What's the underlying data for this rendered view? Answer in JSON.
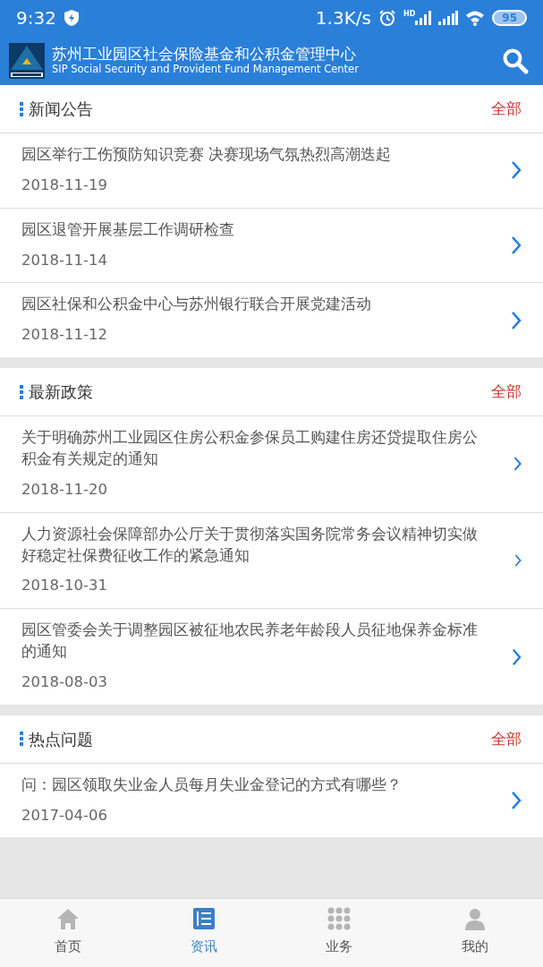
{
  "status_bar": {
    "time": "9:32",
    "speed": "1.3K/s",
    "hd_label": "HD",
    "battery": "95"
  },
  "header": {
    "title": "苏州工业园区社会保险基金和公积金管理中心",
    "subtitle": "SIP Social Security and Provident Fund Management Center"
  },
  "sections": [
    {
      "title": "新闻公告",
      "more": "全部",
      "items": [
        {
          "title": "园区举行工伤预防知识竞赛 决赛现场气氛热烈高潮迭起",
          "date": "2018-11-19"
        },
        {
          "title": "园区退管开展基层工作调研检查",
          "date": "2018-11-14"
        },
        {
          "title": "园区社保和公积金中心与苏州银行联合开展党建活动",
          "date": "2018-11-12"
        }
      ]
    },
    {
      "title": "最新政策",
      "more": "全部",
      "items": [
        {
          "title": "关于明确苏州工业园区住房公积金参保员工购建住房还贷提取住房公积金有关规定的通知",
          "date": "2018-11-20"
        },
        {
          "title": "人力资源社会保障部办公厅关于贯彻落实国务院常务会议精神切实做好稳定社保费征收工作的紧急通知",
          "date": "2018-10-31"
        },
        {
          "title": "园区管委会关于调整园区被征地农民养老年龄段人员征地保养金标准的通知",
          "date": "2018-08-03"
        }
      ]
    },
    {
      "title": "热点问题",
      "more": "全部",
      "items": [
        {
          "title": "问：园区领取失业金人员每月失业金登记的方式有哪些？",
          "date": "2017-04-06"
        }
      ]
    }
  ],
  "tabs": [
    {
      "label": "首页",
      "selected": false
    },
    {
      "label": "资讯",
      "selected": true
    },
    {
      "label": "业务",
      "selected": false
    },
    {
      "label": "我的",
      "selected": false
    }
  ]
}
